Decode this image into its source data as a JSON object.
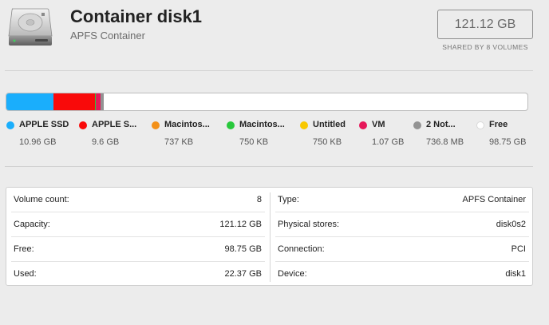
{
  "header": {
    "title": "Container disk1",
    "subtitle": "APFS Container",
    "total_size": "121.12 GB",
    "shared_label": "SHARED BY 8 VOLUMES",
    "icon": "hard-drive-icon"
  },
  "usage_bar": [
    {
      "name": "APPLE SSD",
      "fraction": 0.0905,
      "color": "#1aaefc"
    },
    {
      "name": "APPLE S...",
      "fraction": 0.0793,
      "color": "#f90a0a"
    },
    {
      "name": "Macintos...",
      "fraction": 0.0005,
      "color": "#f39018"
    },
    {
      "name": "Macintos...",
      "fraction": 0.0005,
      "color": "#28c83c"
    },
    {
      "name": "Untitled",
      "fraction": 0.0005,
      "color": "#f8c800"
    },
    {
      "name": "VM",
      "fraction": 0.0088,
      "color": "#e6175a"
    },
    {
      "name": "2 Not...",
      "fraction": 0.0061,
      "color": "#939393"
    }
  ],
  "legend": [
    {
      "name": "APPLE SSD",
      "size": "10.96 GB",
      "color": "#1aaefc"
    },
    {
      "name": "APPLE S...",
      "size": "9.6 GB",
      "color": "#f90a0a"
    },
    {
      "name": "Macintos...",
      "size": "737 KB",
      "color": "#f39018"
    },
    {
      "name": "Macintos...",
      "size": "750 KB",
      "color": "#28c83c"
    },
    {
      "name": "Untitled",
      "size": "750 KB",
      "color": "#f8c800"
    },
    {
      "name": "VM",
      "size": "1.07 GB",
      "color": "#e6175a"
    },
    {
      "name": "2 Not...",
      "size": "736.8 MB",
      "color": "#939393"
    },
    {
      "name": "Free",
      "size": "98.75 GB",
      "color": "#ffffff"
    }
  ],
  "info": {
    "left": [
      {
        "key": "Volume count:",
        "value": "8"
      },
      {
        "key": "Capacity:",
        "value": "121.12 GB"
      },
      {
        "key": "Free:",
        "value": "98.75 GB"
      },
      {
        "key": "Used:",
        "value": "22.37 GB"
      }
    ],
    "right": [
      {
        "key": "Type:",
        "value": "APFS Container"
      },
      {
        "key": "Physical stores:",
        "value": "disk0s2"
      },
      {
        "key": "Connection:",
        "value": "PCI"
      },
      {
        "key": "Device:",
        "value": "disk1"
      }
    ]
  }
}
